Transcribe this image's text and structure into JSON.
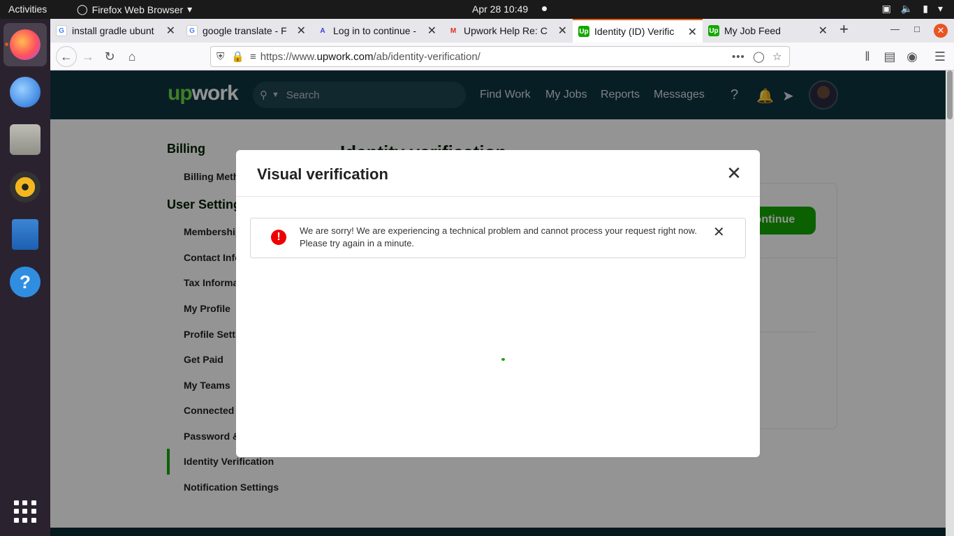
{
  "system_bar": {
    "activities": "Activities",
    "app_name": "Firefox Web Browser",
    "clock": "Apr 28  10:49"
  },
  "dock": {
    "items": [
      "firefox-icon",
      "thunderbird-icon",
      "files-icon",
      "rhythmbox-icon",
      "writer-icon",
      "help-icon"
    ],
    "help_glyph": "?"
  },
  "browser": {
    "tabs": [
      {
        "title": "install gradle ubunt",
        "favicon": "G"
      },
      {
        "title": "google translate - F",
        "favicon": "G"
      },
      {
        "title": "Log in to continue -",
        "favicon": "A"
      },
      {
        "title": "Upwork Help Re: Cc",
        "favicon": "M"
      },
      {
        "title": "Identity (ID) Verific",
        "favicon": "Up"
      },
      {
        "title": "My Job Feed",
        "favicon": "Up"
      }
    ],
    "url_prefix": "https://www.",
    "url_domain": "upwork.com",
    "url_path": "/ab/identity-verification/"
  },
  "upwork": {
    "logo_up": "up",
    "logo_rest": "work",
    "search_placeholder": "Search",
    "nav": [
      "Find Work",
      "My Jobs",
      "Reports",
      "Messages"
    ],
    "help_glyph": "?"
  },
  "sidebar": {
    "billing_heading": "Billing",
    "billing_items": [
      "Billing Methods"
    ],
    "user_settings_heading": "User Settings",
    "items": [
      "Membership",
      "Contact Info",
      "Tax Information",
      "My Profile",
      "Profile Settings",
      "Get Paid",
      "My Teams",
      "Connected",
      "Password &",
      "Identity Verification",
      "Notification Settings"
    ]
  },
  "background": {
    "page_title": "Identity verification",
    "continue_button": "Continue"
  },
  "modal": {
    "title": "Visual verification",
    "alert_text": "We are sorry! We are experiencing a technical problem and cannot process your request right now. Please try again in a minute.",
    "alert_icon": "!"
  }
}
